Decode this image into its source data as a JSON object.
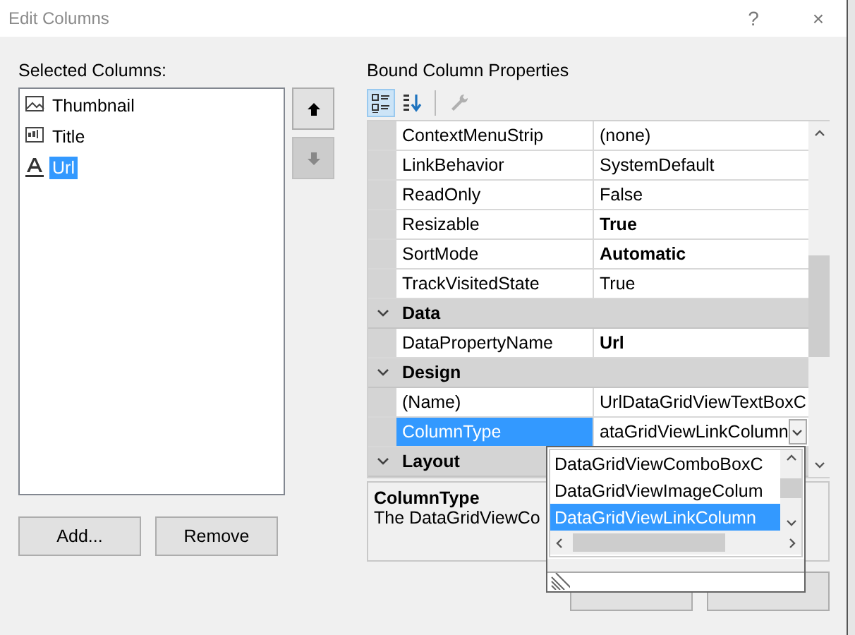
{
  "window": {
    "title": "Edit Columns",
    "help": "?",
    "close": "×"
  },
  "selected_columns": {
    "label": "Selected Columns:",
    "items": [
      {
        "label": "Thumbnail",
        "kind": "image",
        "selected": false
      },
      {
        "label": "Title",
        "kind": "text",
        "selected": false
      },
      {
        "label": "Url",
        "kind": "link",
        "selected": true
      }
    ]
  },
  "move_buttons": [
    {
      "kind": "up",
      "disabled": false
    },
    {
      "kind": "down",
      "disabled": true
    }
  ],
  "list_buttons": [
    "Add...",
    "Remove"
  ],
  "properties": {
    "label": "Bound Column Properties",
    "toolbar": [
      {
        "kind": "categorized",
        "selected": true,
        "disabled": false
      },
      {
        "kind": "alphabetical",
        "selected": false,
        "disabled": false
      },
      {
        "kind": "property-pages",
        "selected": false,
        "disabled": true
      }
    ],
    "rows": [
      {
        "kind": "property",
        "name": "ContextMenuStrip",
        "value": "(none)",
        "bold": false,
        "selected": false
      },
      {
        "kind": "property",
        "name": "LinkBehavior",
        "value": "SystemDefault",
        "bold": false,
        "selected": false
      },
      {
        "kind": "property",
        "name": "ReadOnly",
        "value": "False",
        "bold": false,
        "selected": false
      },
      {
        "kind": "property",
        "name": "Resizable",
        "value": "True",
        "bold": true,
        "selected": false
      },
      {
        "kind": "property",
        "name": "SortMode",
        "value": "Automatic",
        "bold": true,
        "selected": false
      },
      {
        "kind": "property",
        "name": "TrackVisitedState",
        "value": "True",
        "bold": false,
        "selected": false
      },
      {
        "kind": "category",
        "name": "Data",
        "expanded": true
      },
      {
        "kind": "property",
        "name": "DataPropertyName",
        "value": "Url",
        "bold": true,
        "selected": false
      },
      {
        "kind": "category",
        "name": "Design",
        "expanded": true
      },
      {
        "kind": "property",
        "name": "(Name)",
        "value": "UrlDataGridViewTextBoxC",
        "bold": false,
        "selected": false
      },
      {
        "kind": "property",
        "name": "ColumnType",
        "value": "ataGridViewLinkColumn",
        "bold": false,
        "selected": true
      },
      {
        "kind": "category",
        "name": "Layout",
        "expanded": true
      }
    ],
    "dropdown": {
      "items": [
        {
          "label": "DataGridViewComboBoxC",
          "selected": false
        },
        {
          "label": "DataGridViewImageColum",
          "selected": false
        },
        {
          "label": "DataGridViewLinkColumn",
          "selected": true
        }
      ]
    },
    "description": {
      "title": "ColumnType",
      "text": "The DataGridViewCo"
    }
  }
}
